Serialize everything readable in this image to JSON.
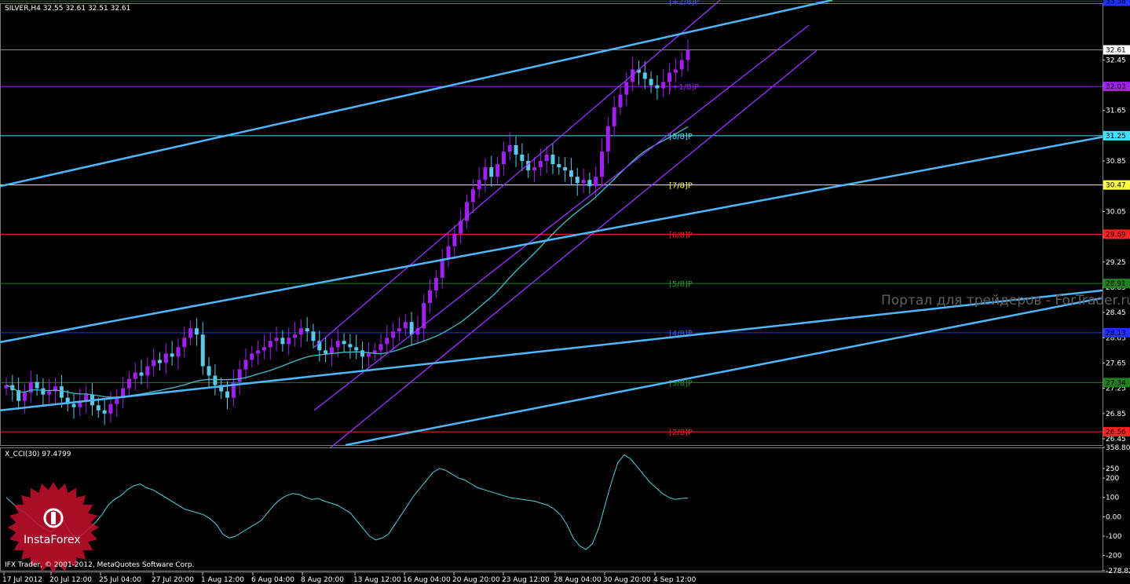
{
  "colors": {
    "background": "#000000",
    "grid": "#16304a",
    "axis": "#c8c8c8",
    "bull_candle": "#a020f0",
    "bear_candle": "#5ec8e8",
    "ma": "#40c0d0",
    "regression": "#9933ff",
    "trendline": "#4db8ff",
    "cci": "#50d0e0"
  },
  "header": {
    "symbol_info": "SILVER,H4  32.55 32.61 32.51 32.61",
    "cci_label": "X_CCI(30) 97.4799",
    "copyright": "IFX Trader, © 2001-2012, MetaQuotes Software Corp.",
    "watermark": "Портал для трейдеров - ForTrader.ru",
    "logo_text": "InstaForex",
    "logo_icon": "instaforex-logo-icon"
  },
  "chart_data": [
    {
      "type": "candlestick",
      "symbol": "SILVER",
      "timeframe": "H4",
      "ylim": [
        26.35,
        33.35
      ],
      "y_ticks": [
        "32.45",
        "32.05",
        "31.65",
        "31.25",
        "30.85",
        "30.47",
        "30.05",
        "29.65",
        "29.25",
        "28.85",
        "28.45",
        "28.05",
        "27.65",
        "27.25",
        "26.85",
        "26.45"
      ],
      "x_ticks": [
        "17 Jul 2012",
        "20 Jul 12:00",
        "25 Jul 04:00",
        "27 Jul 20:00",
        "1 Aug 12:00",
        "6 Aug 04:00",
        "8 Aug 20:00",
        "13 Aug 12:00",
        "16 Aug 04:00",
        "20 Aug 20:00",
        "23 Aug 12:00",
        "28 Aug 04:00",
        "30 Aug 20:00",
        "4 Sep 12:00"
      ],
      "last_price": "32.61",
      "closes": [
        27.3,
        27.22,
        27.05,
        27.18,
        27.35,
        27.25,
        27.15,
        27.2,
        27.28,
        27.1,
        27.0,
        26.95,
        27.05,
        27.15,
        26.98,
        26.9,
        26.85,
        27.0,
        27.1,
        27.25,
        27.4,
        27.5,
        27.45,
        27.6,
        27.7,
        27.65,
        27.8,
        27.75,
        27.9,
        28.05,
        28.2,
        28.1,
        27.6,
        27.45,
        27.3,
        27.2,
        27.1,
        27.35,
        27.55,
        27.7,
        27.8,
        27.85,
        27.9,
        28.0,
        28.05,
        27.95,
        28.05,
        28.1,
        28.2,
        28.15,
        28.0,
        27.85,
        27.8,
        27.9,
        28.0,
        27.95,
        27.9,
        27.85,
        27.75,
        27.8,
        27.85,
        27.95,
        28.05,
        28.15,
        28.2,
        28.3,
        28.1,
        28.2,
        28.6,
        28.8,
        29.0,
        29.3,
        29.5,
        29.7,
        29.9,
        30.2,
        30.4,
        30.55,
        30.75,
        30.6,
        30.8,
        31.0,
        31.1,
        30.95,
        30.85,
        30.7,
        30.75,
        30.85,
        30.95,
        30.8,
        30.75,
        30.7,
        30.6,
        30.5,
        30.55,
        30.45,
        30.6,
        31.0,
        31.4,
        31.7,
        31.9,
        32.1,
        32.3,
        32.25,
        32.15,
        32.05,
        32.0,
        32.1,
        32.25,
        32.3,
        32.45,
        32.61
      ],
      "ma_period": 30,
      "ma_label": "MA"
    },
    {
      "type": "line",
      "name": "X_CCI(30)",
      "value": "97.4799",
      "ylim": [
        -278.822,
        358.801
      ],
      "y_ticks": [
        "358.801",
        "250",
        "200",
        "100",
        "0.00",
        "-100",
        "-200",
        "-278.822"
      ],
      "values": [
        100,
        70,
        40,
        20,
        -10,
        -40,
        -60,
        -80,
        -50,
        -20,
        -80,
        -110,
        -90,
        -60,
        -30,
        10,
        60,
        90,
        110,
        140,
        160,
        170,
        150,
        140,
        120,
        100,
        80,
        60,
        40,
        30,
        20,
        10,
        -10,
        -40,
        -90,
        -110,
        -100,
        -80,
        -60,
        -40,
        -20,
        20,
        60,
        90,
        110,
        120,
        115,
        100,
        90,
        95,
        80,
        70,
        60,
        40,
        20,
        -20,
        -60,
        -100,
        -120,
        -110,
        -90,
        -40,
        10,
        60,
        110,
        150,
        190,
        230,
        250,
        240,
        220,
        200,
        190,
        170,
        150,
        140,
        130,
        120,
        110,
        100,
        95,
        90,
        85,
        80,
        70,
        60,
        40,
        10,
        -40,
        -110,
        -150,
        -170,
        -140,
        -60,
        60,
        180,
        280,
        320,
        300,
        260,
        220,
        180,
        150,
        120,
        100,
        90,
        95,
        97
      ]
    },
    {
      "type": "levels",
      "name": "Murrey Math",
      "levels": [
        {
          "label": "[+2/8]P",
          "price": "33.38",
          "color": "#2030ff",
          "text_color": "#4060ff"
        },
        {
          "label": "[+1/8]P",
          "price": "32.03",
          "color": "#a020f0",
          "text_color": "#a020f0"
        },
        {
          "label": "[8/8]P",
          "price": "31.25",
          "color": "#40e0ff",
          "text_color": "#40e0ff"
        },
        {
          "label": "[7/8]P",
          "price": "30.47",
          "color": "#ffff40",
          "text_color": "#ffff40"
        },
        {
          "label": "[6/8]P",
          "price": "29.69",
          "color": "#ff2020",
          "text_color": "#ff2020"
        },
        {
          "label": "[5/8]P",
          "price": "28.91",
          "color": "#208020",
          "text_color": "#20a020"
        },
        {
          "label": "[4/8]P",
          "price": "28.13",
          "color": "#2030ff",
          "text_color": "#4060ff"
        },
        {
          "label": "[3/8]P",
          "price": "27.34",
          "color": "#208020",
          "text_color": "#20a020"
        },
        {
          "label": "[2/8]P",
          "price": "26.56",
          "color": "#ff2020",
          "text_color": "#ff2020"
        }
      ]
    }
  ]
}
